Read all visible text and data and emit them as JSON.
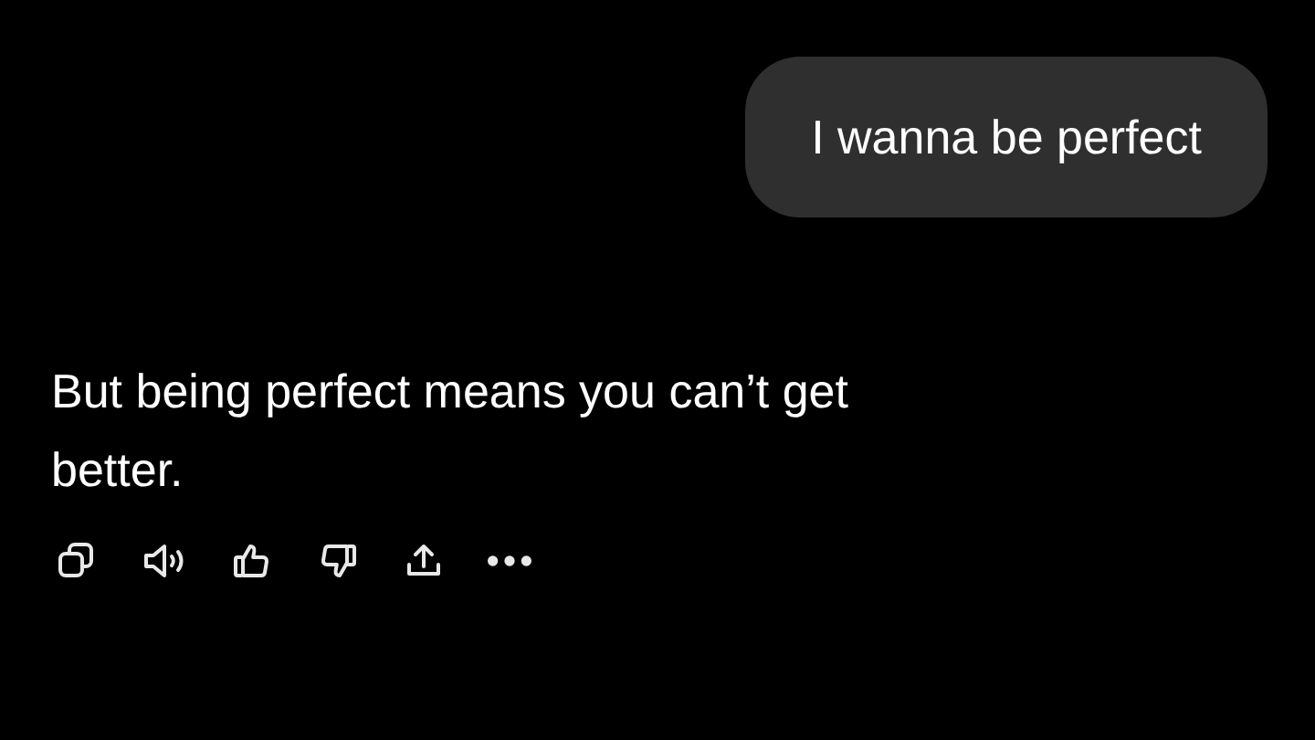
{
  "user_message": {
    "text": "I wanna be perfect"
  },
  "assistant_message": {
    "text": "But being perfect means you can’t get better."
  },
  "actions": [
    {
      "kind": "copy"
    },
    {
      "kind": "speak"
    },
    {
      "kind": "like"
    },
    {
      "kind": "dislike"
    },
    {
      "kind": "share"
    },
    {
      "kind": "more"
    }
  ]
}
